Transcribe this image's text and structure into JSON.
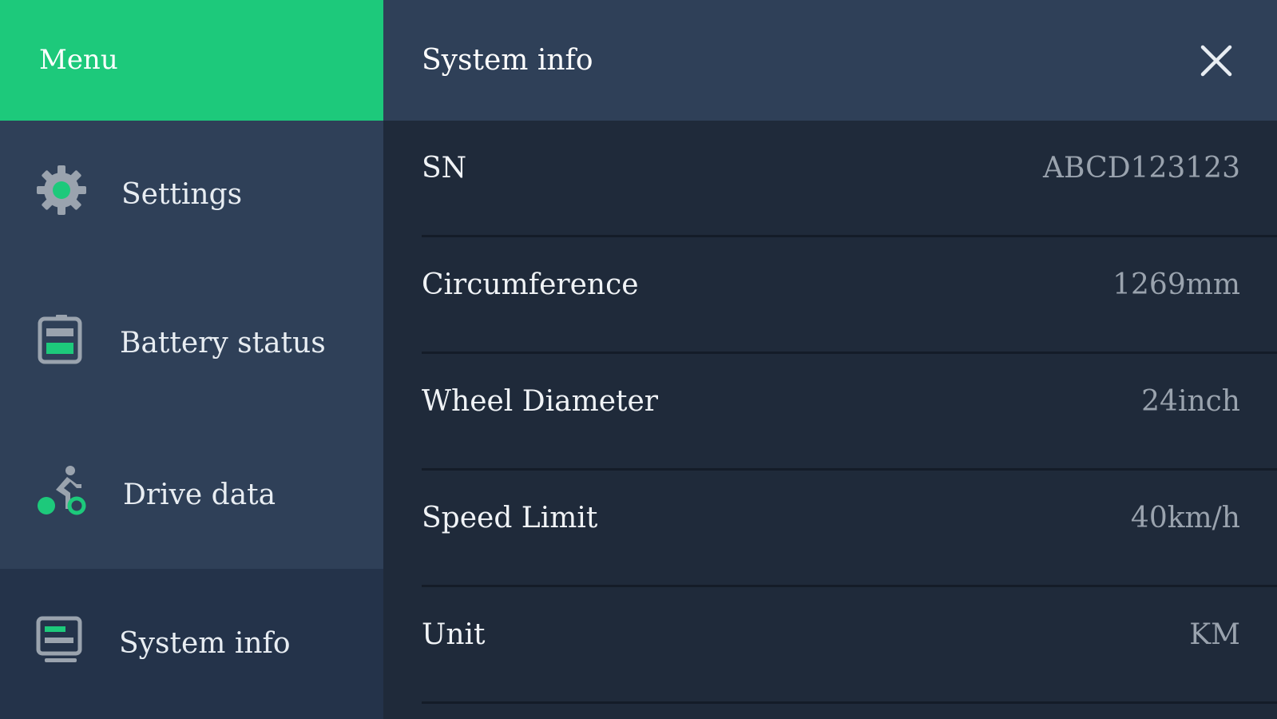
{
  "sidebar": {
    "title": "Menu",
    "items": [
      {
        "label": "Settings",
        "icon": "gear-icon"
      },
      {
        "label": "Battery status",
        "icon": "battery-icon"
      },
      {
        "label": "Drive data",
        "icon": "cyclist-icon"
      },
      {
        "label": "System info",
        "icon": "monitor-icon",
        "active": true
      }
    ]
  },
  "main": {
    "title": "System info",
    "close_icon": "close-icon",
    "rows": [
      {
        "key": "SN",
        "value": "ABCD123123"
      },
      {
        "key": "Circumference",
        "value": "1269mm"
      },
      {
        "key": "Wheel Diameter",
        "value": "24inch"
      },
      {
        "key": "Speed Limit",
        "value": "40km/h"
      },
      {
        "key": "Unit",
        "value": "KM"
      }
    ]
  },
  "colors": {
    "accent": "#1dc97b",
    "panel": "#2f4058",
    "background": "#1f2a3a",
    "active_item": "#24334a"
  }
}
